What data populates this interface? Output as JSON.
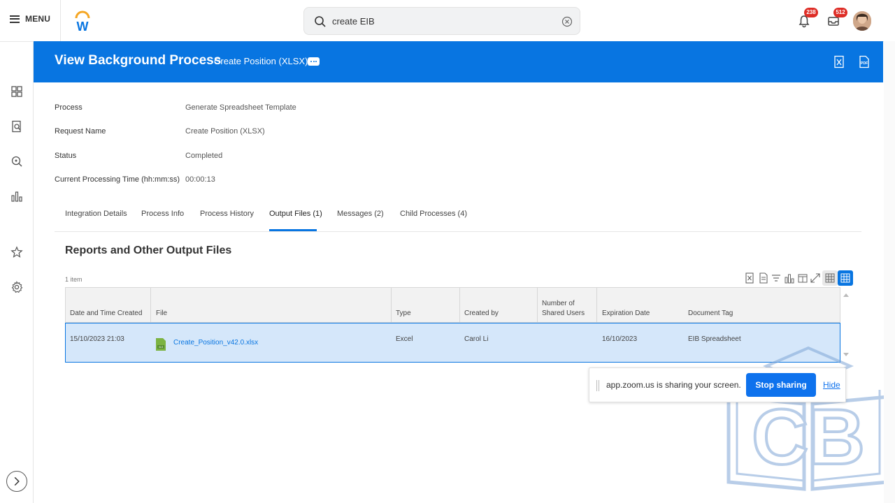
{
  "topbar": {
    "menu_label": "MENU",
    "search": {
      "value": "create EIB",
      "placeholder": "Search"
    },
    "notifications_count": "238",
    "inbox_count": "512"
  },
  "header": {
    "title": "View Background Process",
    "subtitle": "Create Position (XLSX)",
    "accent_color": "#0875e1"
  },
  "fields": [
    {
      "label": "Process",
      "value": "Generate Spreadsheet Template"
    },
    {
      "label": "Request Name",
      "value": "Create Position (XLSX)"
    },
    {
      "label": "Status",
      "value": "Completed"
    },
    {
      "label": "Current Processing Time (hh:mm:ss)",
      "value": "00:00:13"
    }
  ],
  "tabs": [
    {
      "label": "Integration Details"
    },
    {
      "label": "Process Info"
    },
    {
      "label": "Process History"
    },
    {
      "label": "Output Files (1)",
      "active": true
    },
    {
      "label": "Messages (2)"
    },
    {
      "label": "Child Processes (4)"
    }
  ],
  "output": {
    "section_title": "Reports and Other Output Files",
    "item_count": "1 item",
    "columns": [
      "Date and Time Created",
      "File",
      "Type",
      "Created by",
      "Number of Shared Users",
      "Expiration Date",
      "Document Tag"
    ],
    "rows": [
      {
        "date": "15/10/2023 21:03",
        "file": "Create_Position_v42.0.xlsx",
        "type": "Excel",
        "created_by": "Carol Li",
        "shared_users": "",
        "expiration": "16/10/2023",
        "tag": "EIB Spreadsheet"
      }
    ]
  },
  "zoom_bar": {
    "message": "app.zoom.us is sharing your screen.",
    "stop_label": "Stop sharing",
    "hide_label": "Hide"
  },
  "watermark": {
    "text": "CB"
  }
}
